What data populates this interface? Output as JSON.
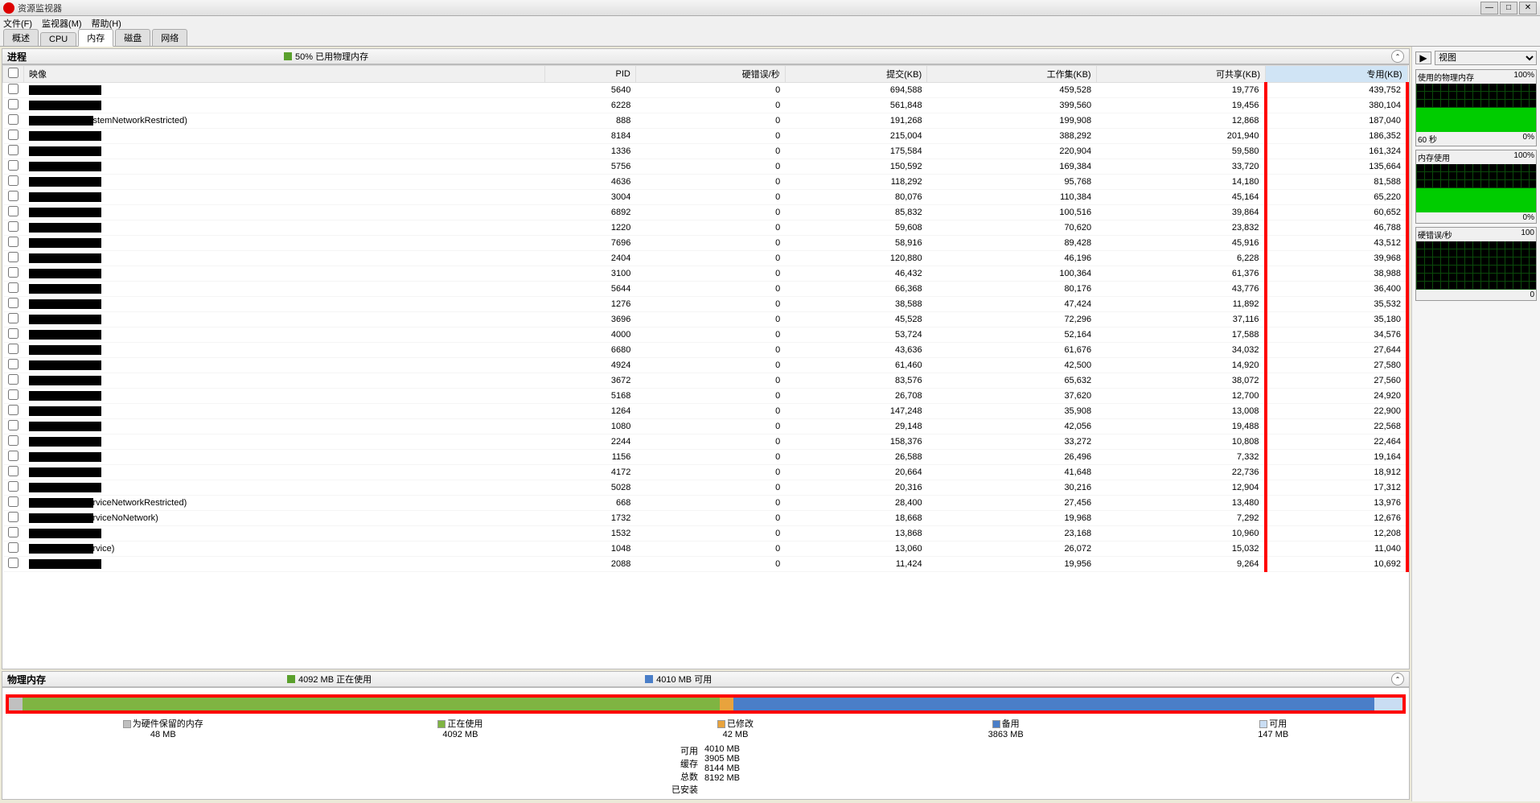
{
  "window": {
    "title": "资源监视器",
    "min": "—",
    "max": "□",
    "close": "✕"
  },
  "menu": [
    "文件(F)",
    "监视器(M)",
    "帮助(H)"
  ],
  "tabs": {
    "items": [
      "概述",
      "CPU",
      "内存",
      "磁盘",
      "网络"
    ],
    "active": 2
  },
  "processPanel": {
    "title": "进程",
    "statLabel": "50% 已用物理内存",
    "statColor": "#5aa02c",
    "columns": [
      "映像",
      "PID",
      "硬错误/秒",
      "提交(KB)",
      "工作集(KB)",
      "可共享(KB)",
      "专用(KB)"
    ],
    "highlightedCol": 6,
    "rows": [
      {
        "image": "",
        "pid": 5640,
        "hf": 0,
        "commit": "694,588",
        "ws": "459,528",
        "share": "19,776",
        "priv": "439,752"
      },
      {
        "image": "",
        "pid": 6228,
        "hf": 0,
        "commit": "561,848",
        "ws": "399,560",
        "share": "19,456",
        "priv": "380,104"
      },
      {
        "image": "stemNetworkRestricted)",
        "pid": 888,
        "hf": 0,
        "commit": "191,268",
        "ws": "199,908",
        "share": "12,868",
        "priv": "187,040"
      },
      {
        "image": "",
        "pid": 8184,
        "hf": 0,
        "commit": "215,004",
        "ws": "388,292",
        "share": "201,940",
        "priv": "186,352"
      },
      {
        "image": "",
        "pid": 1336,
        "hf": 0,
        "commit": "175,584",
        "ws": "220,904",
        "share": "59,580",
        "priv": "161,324"
      },
      {
        "image": "",
        "pid": 5756,
        "hf": 0,
        "commit": "150,592",
        "ws": "169,384",
        "share": "33,720",
        "priv": "135,664"
      },
      {
        "image": "",
        "pid": 4636,
        "hf": 0,
        "commit": "118,292",
        "ws": "95,768",
        "share": "14,180",
        "priv": "81,588"
      },
      {
        "image": "",
        "pid": 3004,
        "hf": 0,
        "commit": "80,076",
        "ws": "110,384",
        "share": "45,164",
        "priv": "65,220"
      },
      {
        "image": "",
        "pid": 6892,
        "hf": 0,
        "commit": "85,832",
        "ws": "100,516",
        "share": "39,864",
        "priv": "60,652"
      },
      {
        "image": "",
        "pid": 1220,
        "hf": 0,
        "commit": "59,608",
        "ws": "70,620",
        "share": "23,832",
        "priv": "46,788"
      },
      {
        "image": "",
        "pid": 7696,
        "hf": 0,
        "commit": "58,916",
        "ws": "89,428",
        "share": "45,916",
        "priv": "43,512"
      },
      {
        "image": "",
        "pid": 2404,
        "hf": 0,
        "commit": "120,880",
        "ws": "46,196",
        "share": "6,228",
        "priv": "39,968"
      },
      {
        "image": "",
        "pid": 3100,
        "hf": 0,
        "commit": "46,432",
        "ws": "100,364",
        "share": "61,376",
        "priv": "38,988"
      },
      {
        "image": "",
        "pid": 5644,
        "hf": 0,
        "commit": "66,368",
        "ws": "80,176",
        "share": "43,776",
        "priv": "36,400"
      },
      {
        "image": "",
        "pid": 1276,
        "hf": 0,
        "commit": "38,588",
        "ws": "47,424",
        "share": "11,892",
        "priv": "35,532"
      },
      {
        "image": "",
        "pid": 3696,
        "hf": 0,
        "commit": "45,528",
        "ws": "72,296",
        "share": "37,116",
        "priv": "35,180"
      },
      {
        "image": "",
        "pid": 4000,
        "hf": 0,
        "commit": "53,724",
        "ws": "52,164",
        "share": "17,588",
        "priv": "34,576"
      },
      {
        "image": "",
        "pid": 6680,
        "hf": 0,
        "commit": "43,636",
        "ws": "61,676",
        "share": "34,032",
        "priv": "27,644"
      },
      {
        "image": "",
        "pid": 4924,
        "hf": 0,
        "commit": "61,460",
        "ws": "42,500",
        "share": "14,920",
        "priv": "27,580"
      },
      {
        "image": "",
        "pid": 3672,
        "hf": 0,
        "commit": "83,576",
        "ws": "65,632",
        "share": "38,072",
        "priv": "27,560"
      },
      {
        "image": "",
        "pid": 5168,
        "hf": 0,
        "commit": "26,708",
        "ws": "37,620",
        "share": "12,700",
        "priv": "24,920"
      },
      {
        "image": "",
        "pid": 1264,
        "hf": 0,
        "commit": "147,248",
        "ws": "35,908",
        "share": "13,008",
        "priv": "22,900"
      },
      {
        "image": "",
        "pid": 1080,
        "hf": 0,
        "commit": "29,148",
        "ws": "42,056",
        "share": "19,488",
        "priv": "22,568"
      },
      {
        "image": "",
        "pid": 2244,
        "hf": 0,
        "commit": "158,376",
        "ws": "33,272",
        "share": "10,808",
        "priv": "22,464"
      },
      {
        "image": "",
        "pid": 1156,
        "hf": 0,
        "commit": "26,588",
        "ws": "26,496",
        "share": "7,332",
        "priv": "19,164"
      },
      {
        "image": "",
        "pid": 4172,
        "hf": 0,
        "commit": "20,664",
        "ws": "41,648",
        "share": "22,736",
        "priv": "18,912"
      },
      {
        "image": "",
        "pid": 5028,
        "hf": 0,
        "commit": "20,316",
        "ws": "30,216",
        "share": "12,904",
        "priv": "17,312"
      },
      {
        "image": "rviceNetworkRestricted)",
        "pid": 668,
        "hf": 0,
        "commit": "28,400",
        "ws": "27,456",
        "share": "13,480",
        "priv": "13,976"
      },
      {
        "image": "rviceNoNetwork)",
        "pid": 1732,
        "hf": 0,
        "commit": "18,668",
        "ws": "19,968",
        "share": "7,292",
        "priv": "12,676"
      },
      {
        "image": "",
        "pid": 1532,
        "hf": 0,
        "commit": "13,868",
        "ws": "23,168",
        "share": "10,960",
        "priv": "12,208"
      },
      {
        "image": "rvice)",
        "pid": 1048,
        "hf": 0,
        "commit": "13,060",
        "ws": "26,072",
        "share": "15,032",
        "priv": "11,040"
      },
      {
        "image": "",
        "pid": 2088,
        "hf": 0,
        "commit": "11,424",
        "ws": "19,956",
        "share": "9,264",
        "priv": "10,692"
      }
    ]
  },
  "physMemPanel": {
    "title": "物理内存",
    "stat1Label": "4092 MB 正在使用",
    "stat1Color": "#5aa02c",
    "stat2Label": "4010 MB 可用",
    "stat2Color": "#4a7ec8",
    "segments": [
      {
        "label": "为硬件保留的内存",
        "value": "48 MB",
        "color": "#c0c0c0",
        "pct": 1
      },
      {
        "label": "正在使用",
        "value": "4092 MB",
        "color": "#7fb442",
        "pct": 50
      },
      {
        "label": "已修改",
        "value": "42 MB",
        "color": "#e8a33d",
        "pct": 1
      },
      {
        "label": "备用",
        "value": "3863 MB",
        "color": "#4a7ec8",
        "pct": 46
      },
      {
        "label": "可用",
        "value": "147 MB",
        "color": "#c9ddf3",
        "pct": 2
      }
    ],
    "summary": [
      {
        "label": "可用",
        "value": "4010 MB"
      },
      {
        "label": "缓存",
        "value": "3905 MB"
      },
      {
        "label": "总数",
        "value": "8144 MB"
      },
      {
        "label": "已安装",
        "value": "8192 MB"
      }
    ]
  },
  "sidebar": {
    "viewLabel": "视图",
    "graphs": [
      {
        "title": "使用的物理内存",
        "topRight": "100%",
        "botLeft": "60 秒",
        "botRight": "0%",
        "fill": 50
      },
      {
        "title": "内存使用",
        "topRight": "100%",
        "botLeft": "",
        "botRight": "0%",
        "fill": 50
      },
      {
        "title": "硬错误/秒",
        "topRight": "100",
        "botLeft": "",
        "botRight": "0",
        "fill": 0
      }
    ]
  }
}
